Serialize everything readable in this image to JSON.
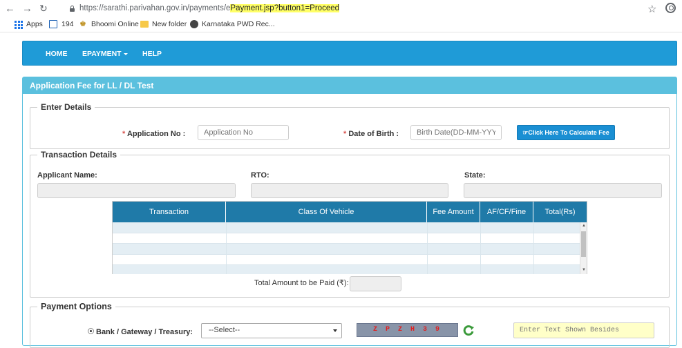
{
  "browser": {
    "url_prefix": "https://sarathi.parivahan.gov.in/payments/",
    "url_first_char": "e",
    "url_highlight": "Payment.jsp?button1=Proceed",
    "bookmarks": [
      "Apps",
      "194",
      "Bhoomi Online",
      "New folder",
      "Karnataka PWD Rec..."
    ]
  },
  "nav": {
    "home": "HOME",
    "epayment": "EPAYMENT",
    "help": "HELP"
  },
  "panel": {
    "title": "Application Fee for LL / DL Test"
  },
  "enter_details": {
    "legend": "Enter Details",
    "app_no_label": "Application No :",
    "app_no_placeholder": "Application No",
    "dob_label": "Date of Birth :",
    "dob_placeholder": "Birth Date(DD-MM-YYYY",
    "calc_button": "Click Here To Calculate Fee",
    "required_mark": "*"
  },
  "transaction": {
    "legend": "Transaction Details",
    "applicant_label": "Applicant Name:",
    "rto_label": "RTO:",
    "state_label": "State:",
    "columns": [
      "Transaction",
      "Class Of Vehicle",
      "Fee Amount",
      "AF/CF/Fine",
      "Total(Rs)"
    ],
    "total_label": "Total Amount to be Paid (₹):"
  },
  "payment": {
    "legend": "Payment Options",
    "bank_label": "Bank / Gateway / Treasury:",
    "select_value": "--Select--",
    "captcha_text": "Z P Z H 3 9",
    "captcha_placeholder": "Enter Text Shown Besides"
  }
}
